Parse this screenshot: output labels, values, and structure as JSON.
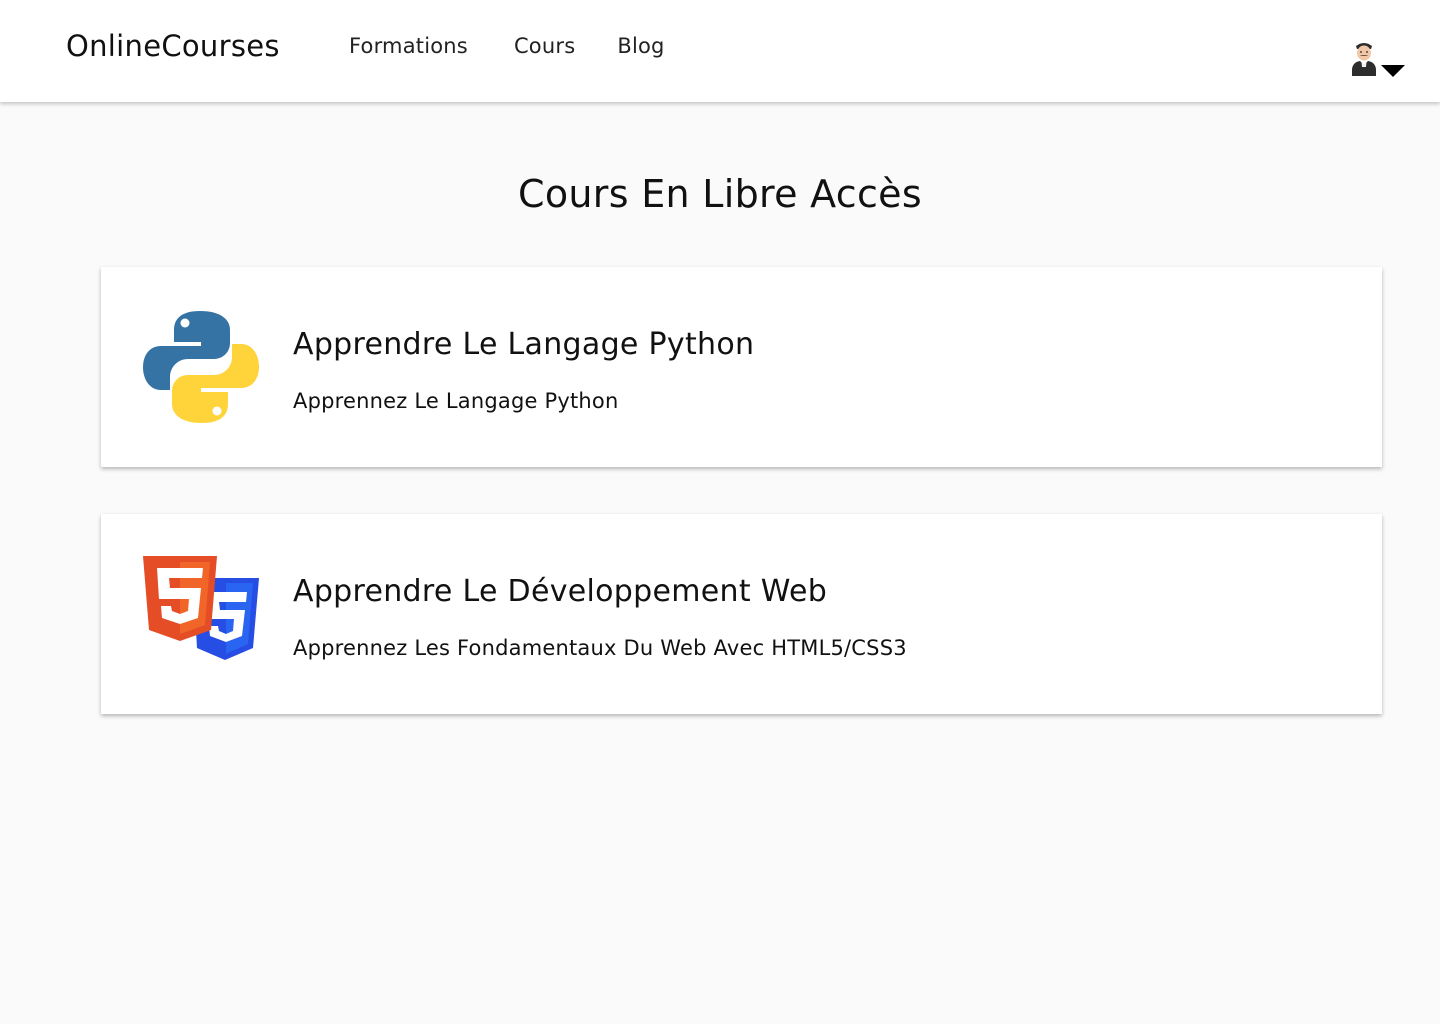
{
  "header": {
    "brand": "OnlineCourses",
    "nav": [
      {
        "label": "Formations"
      },
      {
        "label": "Cours"
      },
      {
        "label": "Blog"
      }
    ],
    "user_menu_icon": "avatar-with-dropdown-caret"
  },
  "main": {
    "title": "Cours En Libre Accès",
    "courses": [
      {
        "title": "Apprendre Le Langage Python",
        "description": "Apprennez Le Langage Python",
        "logo": "python-logo"
      },
      {
        "title": "Apprendre Le Développement Web",
        "description": "Apprennez Les Fondamentaux Du Web Avec HTML5/CSS3",
        "logo": "html5-css3-logo"
      }
    ]
  },
  "colors": {
    "background": "#fafafa",
    "surface": "#ffffff",
    "python_blue": "#3673a5",
    "python_yellow": "#ffd43b",
    "html5_orange": "#e44d26",
    "css3_blue": "#264de4"
  }
}
